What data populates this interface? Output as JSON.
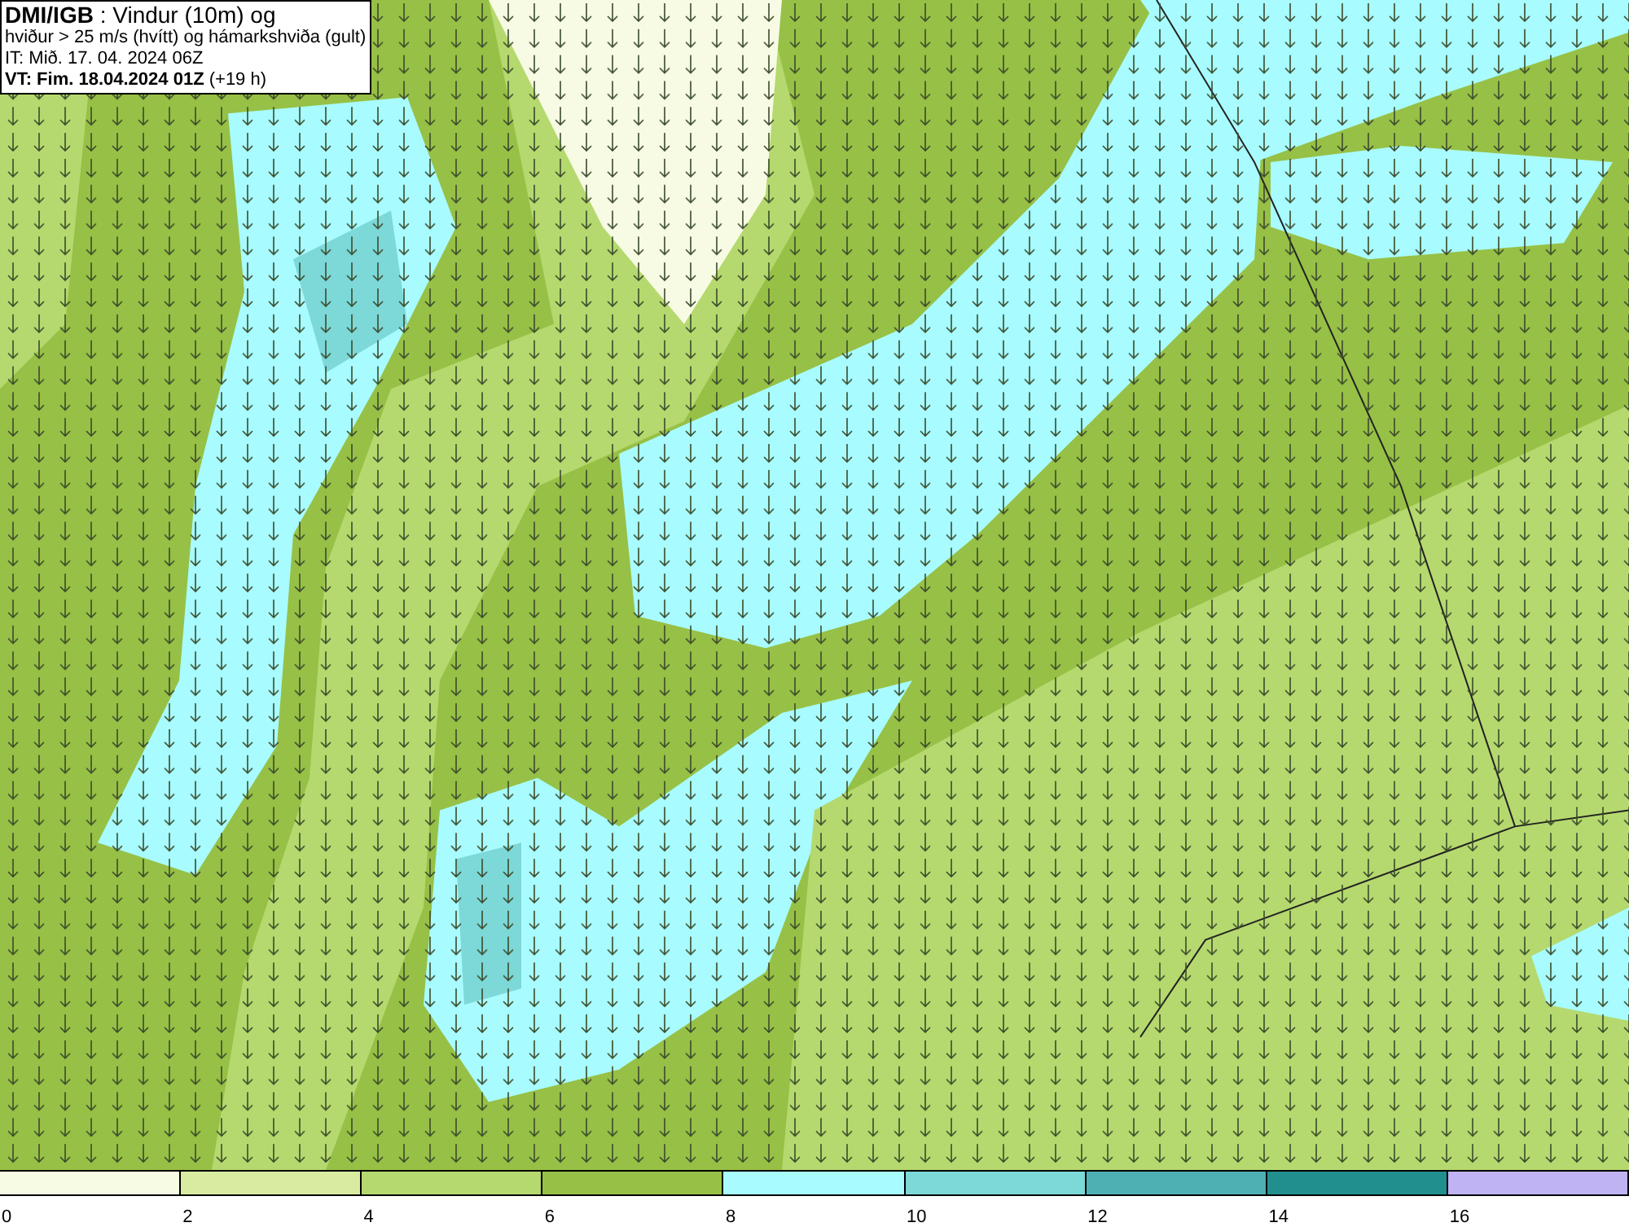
{
  "header": {
    "lines": [
      {
        "kind": "title",
        "text": "**DMI/IGB** : Vindur (10m) og"
      },
      {
        "kind": "plain",
        "text": "hviður > 25 m/s (hvítt) og hámarkshviða (gult)"
      },
      {
        "kind": "plain",
        "text": "IT: Mið. 17. 04. 2024 06Z"
      },
      {
        "kind": "plain",
        "text": "**VT: Fim. 18.04.2024 01Z** (+19 h)"
      }
    ]
  },
  "legend": {
    "segments": [
      {
        "color": "#f7fbe4"
      },
      {
        "color": "#d8eba0"
      },
      {
        "color": "#b5d96e"
      },
      {
        "color": "#97c046"
      },
      {
        "color": "#a8fbfe"
      },
      {
        "color": "#7dd8d8"
      },
      {
        "color": "#4fb0b3"
      },
      {
        "color": "#218f8e"
      },
      {
        "color": "#c0b3f4"
      }
    ],
    "ticks": [
      "0",
      "2",
      "4",
      "6",
      "8",
      "10",
      "12",
      "14",
      "16"
    ]
  }
}
